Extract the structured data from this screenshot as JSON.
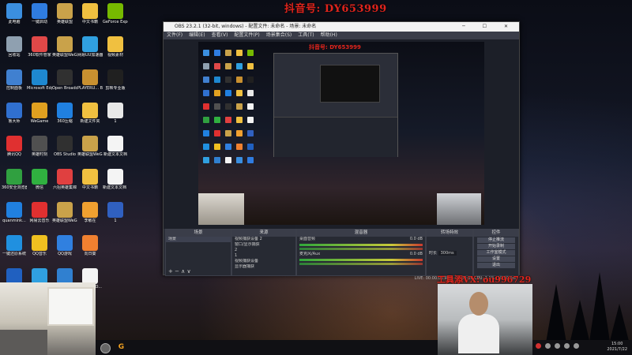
{
  "overlay": {
    "douyin_id": "抖音号:  DY653999",
    "wechat": "工具添VX: ou996729"
  },
  "desktop_icons": [
    {
      "label": "此电脑",
      "color": "#3b8fe0",
      "col": 0,
      "row": 0
    },
    {
      "label": "一键启动",
      "color": "#2f7ce0",
      "col": 1,
      "row": 0
    },
    {
      "label": "英雄联盟",
      "color": "#c9a24a",
      "col": 2,
      "row": 0
    },
    {
      "label": "中文书籍",
      "color": "#f0c040",
      "col": 3,
      "row": 0
    },
    {
      "label": "GeForce Experience",
      "color": "#76b900",
      "col": 4,
      "row": 0
    },
    {
      "label": "回收站",
      "color": "#8fa0b0",
      "col": 0,
      "row": 1
    },
    {
      "label": "360软件管家",
      "color": "#e04848",
      "col": 1,
      "row": 1
    },
    {
      "label": "英雄联盟WeGame版",
      "color": "#c9a24a",
      "col": 2,
      "row": 1
    },
    {
      "label": "网易UU加速器",
      "color": "#30a0e0",
      "col": 3,
      "row": 1
    },
    {
      "label": "视频素材",
      "color": "#f0c040",
      "col": 4,
      "row": 1
    },
    {
      "label": "控制面板",
      "color": "#4080d0",
      "col": 0,
      "row": 2
    },
    {
      "label": "Microsoft Edge",
      "color": "#1e88d0",
      "col": 1,
      "row": 2
    },
    {
      "label": "Open Broadcast...",
      "color": "#303030",
      "col": 2,
      "row": 2
    },
    {
      "label": "PLAYERU... BATTLEGR...",
      "color": "#c89030",
      "col": 3,
      "row": 2
    },
    {
      "label": "剪映专业版",
      "color": "#202020",
      "col": 4,
      "row": 2
    },
    {
      "label": "鲁大师",
      "color": "#3070d0",
      "col": 0,
      "row": 3
    },
    {
      "label": "WeGame",
      "color": "#e0a020",
      "col": 1,
      "row": 3
    },
    {
      "label": "360压缩",
      "color": "#2080e0",
      "col": 2,
      "row": 3
    },
    {
      "label": "新建文件夹",
      "color": "#f0c040",
      "col": 3,
      "row": 3
    },
    {
      "label": "1",
      "color": "#e8e8e8",
      "col": 4,
      "row": 3
    },
    {
      "label": "腾讯QQ",
      "color": "#e03030",
      "col": 0,
      "row": 4
    },
    {
      "label": "英雄时刻",
      "color": "#505050",
      "col": 1,
      "row": 4
    },
    {
      "label": "OBS Studio",
      "color": "#303030",
      "col": 2,
      "row": 4
    },
    {
      "label": "英雄联盟WeGame版",
      "color": "#c9a24a",
      "col": 3,
      "row": 4
    },
    {
      "label": "新建文本文档",
      "color": "#f4f4f4",
      "col": 4,
      "row": 4
    },
    {
      "label": "360安全浏览器",
      "color": "#30a040",
      "col": 0,
      "row": 5
    },
    {
      "label": "微信",
      "color": "#30b040",
      "col": 1,
      "row": 5
    },
    {
      "label": "六招英雄集锦",
      "color": "#e04040",
      "col": 2,
      "row": 5
    },
    {
      "label": "中文书籍",
      "color": "#f0c040",
      "col": 3,
      "row": 5
    },
    {
      "label": "新建文本文档 (2)",
      "color": "#f4f4f4",
      "col": 4,
      "row": 5
    },
    {
      "label": "quanmink...",
      "color": "#2080e0",
      "col": 0,
      "row": 6
    },
    {
      "label": "网易云音乐",
      "color": "#e03030",
      "col": 1,
      "row": 6
    },
    {
      "label": "英雄联盟WeGame版",
      "color": "#c9a24a",
      "col": 2,
      "row": 6
    },
    {
      "label": "李敏在",
      "color": "#f0a030",
      "col": 3,
      "row": 6
    },
    {
      "label": "1",
      "color": "#3060c0",
      "col": 4,
      "row": 6
    },
    {
      "label": "一键还原系统",
      "color": "#2090e0",
      "col": 0,
      "row": 7
    },
    {
      "label": "QQ音乐",
      "color": "#f0c020",
      "col": 1,
      "row": 7
    },
    {
      "label": "QQ游戏",
      "color": "#3080e0",
      "col": 2,
      "row": 7
    },
    {
      "label": "向日葵",
      "color": "#f08030",
      "col": 3,
      "row": 7
    },
    {
      "label": "",
      "color": "#2060c0",
      "col": 0,
      "row": 8
    },
    {
      "label": "",
      "color": "#30a0e0",
      "col": 1,
      "row": 8
    },
    {
      "label": "",
      "color": "#3080d0",
      "col": 2,
      "row": 8
    },
    {
      "label": "ISBTFLJEO...",
      "color": "#f4f4f4",
      "col": 3,
      "row": 8
    }
  ],
  "obs": {
    "title": "OBS 23.2.1 (32-bit, windows) - 配置文件: 未命名 - 场景: 未命名",
    "menu": [
      "文件(F)",
      "编辑(E)",
      "查看(V)",
      "配置文件(P)",
      "场景集合(S)",
      "工具(T)",
      "帮助(H)"
    ],
    "inner_banner": "抖音号: DY653999",
    "docks": {
      "scenes": {
        "header": "场景",
        "items": [
          "场景"
        ]
      },
      "sources": {
        "header": "来源",
        "items": [
          "视频捕获设备 2",
          "窗口/显示捕获",
          "2",
          "1",
          "视频捕获设备",
          "显示器捕获"
        ]
      },
      "mixer": {
        "header": "混音器",
        "channels": [
          {
            "name": "桌面音频",
            "db": "0.0 dB"
          },
          {
            "name": "麦克风/Aux",
            "db": "0.0 dB"
          }
        ]
      },
      "transitions": {
        "header": "转场特效",
        "duration_label": "时长",
        "duration": "300ms"
      },
      "controls": {
        "header": "控件",
        "buttons": [
          "停止推流",
          "开始录制",
          "工作室模式",
          "设置",
          "退出"
        ]
      }
    },
    "status": "LIVE: 00:00:00   REC: 00:00:00   CPU: 2.1%, 30.00 fps"
  },
  "tray": {
    "time": "15:00",
    "date": "2021/7/22"
  }
}
